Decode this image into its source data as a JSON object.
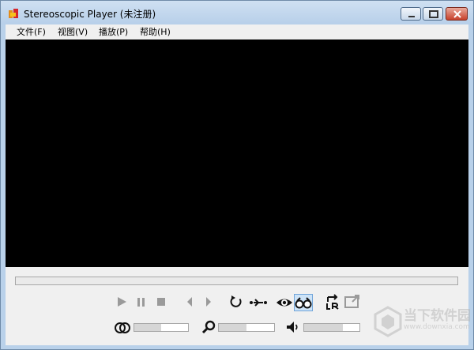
{
  "window": {
    "title": "Stereoscopic Player (未注册)"
  },
  "menubar": {
    "items": [
      {
        "label": "文件(F)"
      },
      {
        "label": "视图(V)"
      },
      {
        "label": "播放(P)"
      },
      {
        "label": "帮助(H)"
      }
    ]
  },
  "playback": {
    "position": 0
  },
  "sliders": {
    "balance_level": 0.5,
    "zoom_level": 0.5,
    "volume_level": 0.7
  },
  "controls": {
    "icons": [
      "play-icon",
      "pause-icon",
      "stop-icon",
      "previous-frame-icon",
      "next-frame-icon",
      "loop-icon",
      "swap-views-icon",
      "eye-icon",
      "stereo-glasses-icon",
      "swap-left-right-icon",
      "fullscreen-icon",
      "overlap-circles-icon",
      "magnifier-icon",
      "speaker-icon"
    ],
    "stereo_glasses_selected": true
  },
  "watermark": {
    "brand": "当下软件园",
    "url": "www.downxia.com"
  },
  "colors": {
    "video_background": "#000000",
    "frame": "#b9d1ea",
    "close_button": "#c7402b"
  }
}
